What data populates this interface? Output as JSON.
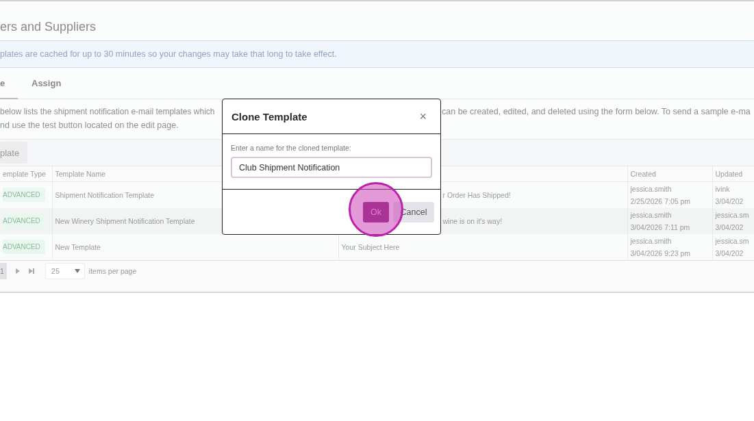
{
  "page_title": "ers and Suppliers",
  "notice": "plates are cached for up to 30 minutes so your changes may take that long to take effect.",
  "tabs": [
    {
      "label": "e",
      "selected": true
    },
    {
      "label": "Assign",
      "selected": false
    }
  ],
  "description": {
    "line_1_left": "below lists the shipment notification e-mail templates which",
    "line_1_right": "can be created, edited, and deleted using the form below. To send a sample e-ma",
    "line_2": "nd use the test button located on the edit page."
  },
  "toolbar": {
    "button": "plate"
  },
  "table": {
    "columns": [
      "emplate Type",
      "Template Name",
      "Created",
      "Updated"
    ],
    "rows": [
      {
        "type": "ADVANCED",
        "name": "Shipment Notification Template",
        "subject": "r Order Has Shipped!",
        "created_by": "jessica.smith",
        "created_at": "2/25/2026 7:05 pm",
        "updated_by": "ivink",
        "updated_at": "3/04/202"
      },
      {
        "type": "ADVANCED",
        "name": "New Winery Shipment Notification Template",
        "subject": "wine is on it's way!",
        "created_by": "jessica.smith",
        "created_at": "3/04/2026 7:11 pm",
        "updated_by": "jessica.sm",
        "updated_at": "3/04/202"
      },
      {
        "type": "ADVANCED",
        "name": "New Template",
        "subject": "Your Subject Here",
        "created_by": "jessica.smith",
        "created_at": "3/04/2026 9:23 pm",
        "updated_by": "jessica.sm",
        "updated_at": "3/04/202"
      }
    ]
  },
  "pager": {
    "pages": [
      {
        "label": "1",
        "selected": true
      }
    ],
    "per_page": "25",
    "per_page_label": "items per page"
  },
  "dialog": {
    "title": "Clone Template",
    "close": "×",
    "prompt": "Enter a name for the cloned template:",
    "value": "Club Shipment Notification",
    "ok": "Ok",
    "cancel": "Cancel"
  }
}
